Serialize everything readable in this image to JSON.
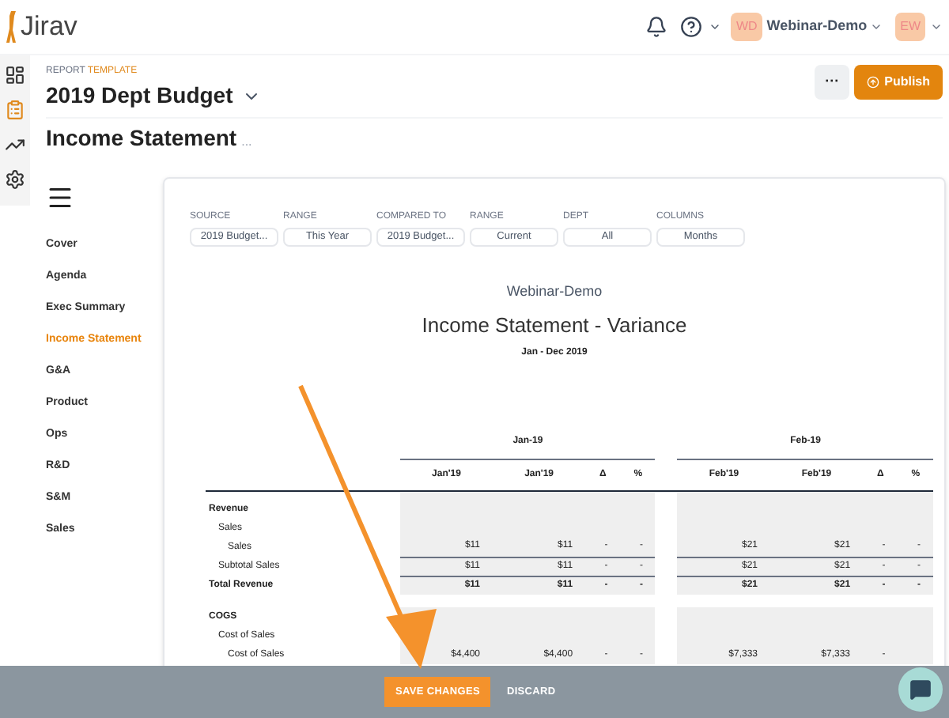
{
  "app": {
    "logo": "Jirav"
  },
  "header": {
    "org_initials": "WD",
    "org_name": "Webinar-Demo",
    "user_initials": "EW"
  },
  "rail": [
    {
      "selected": false
    },
    {
      "selected": true
    },
    {
      "selected": false
    },
    {
      "selected": false
    }
  ],
  "report": {
    "label": "REPORT",
    "label_accent": "TEMPLATE",
    "title": "2019 Dept Budget",
    "more": "···",
    "publish": "Publish"
  },
  "page_title": "Income Statement",
  "page_title_more": "...",
  "sidebar": {
    "items": [
      {
        "label": "Cover",
        "selected": false
      },
      {
        "label": "Agenda",
        "selected": false
      },
      {
        "label": "Exec Summary",
        "selected": false
      },
      {
        "label": "Income Statement",
        "selected": true
      },
      {
        "label": "G&A",
        "selected": false
      },
      {
        "label": "Product",
        "selected": false
      },
      {
        "label": "Ops",
        "selected": false
      },
      {
        "label": "R&D",
        "selected": false
      },
      {
        "label": "S&M",
        "selected": false
      },
      {
        "label": "Sales",
        "selected": false
      }
    ]
  },
  "filters": [
    {
      "label": "SOURCE",
      "value": "2019 Budget..."
    },
    {
      "label": "RANGE",
      "value": "This Year"
    },
    {
      "label": "COMPARED TO",
      "value": "2019 Budget..."
    },
    {
      "label": "RANGE",
      "value": "Current"
    },
    {
      "label": "DEPT",
      "value": "All"
    },
    {
      "label": "COLUMNS",
      "value": "Months"
    }
  ],
  "statement": {
    "company": "Webinar-Demo",
    "title": "Income Statement - Variance",
    "period": "Jan - Dec 2019"
  },
  "table": {
    "groups": [
      "Jan-19",
      "Feb-19"
    ],
    "columns": [
      [
        "Jan'19",
        "Jan'19",
        "Δ",
        "%"
      ],
      [
        "Feb'19",
        "Feb'19",
        "Δ",
        "%"
      ]
    ],
    "rows": [
      {
        "kind": "section",
        "label": "Revenue"
      },
      {
        "kind": "group",
        "label": "Sales"
      },
      {
        "kind": "line",
        "label": "Sales",
        "values": [
          [
            "$11",
            "$11",
            "-",
            "-"
          ],
          [
            "$21",
            "$21",
            "-",
            "-"
          ]
        ]
      },
      {
        "kind": "subtotal",
        "label": "Subtotal Sales",
        "values": [
          [
            "$11",
            "$11",
            "-",
            "-"
          ],
          [
            "$21",
            "$21",
            "-",
            "-"
          ]
        ]
      },
      {
        "kind": "total",
        "label": "Total Revenue",
        "values": [
          [
            "$11",
            "$11",
            "-",
            "-"
          ],
          [
            "$21",
            "$21",
            "-",
            "-"
          ]
        ]
      },
      {
        "kind": "spacer"
      },
      {
        "kind": "section",
        "label": "COGS"
      },
      {
        "kind": "group",
        "label": "Cost of Sales"
      },
      {
        "kind": "line",
        "label": "Cost of Sales",
        "values": [
          [
            "$4,400",
            "$4,400",
            "-",
            "-"
          ],
          [
            "$7,333",
            "$7,333",
            "-"
          ]
        ]
      }
    ]
  },
  "action_bar": {
    "save": "SAVE CHANGES",
    "discard": "DISCARD"
  }
}
